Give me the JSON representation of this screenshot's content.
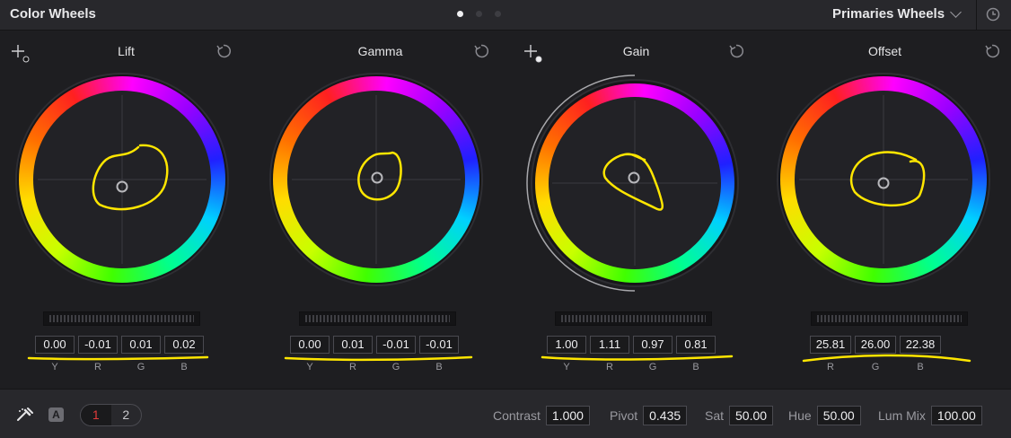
{
  "header": {
    "title": "Color Wheels",
    "mode_label": "Primaries Wheels",
    "page_dots": 3,
    "active_dot": 0
  },
  "wheels": [
    {
      "id": "lift",
      "title": "Lift",
      "values": [
        "0.00",
        "-0.01",
        "0.01",
        "0.02"
      ],
      "labels": [
        "Y",
        "R",
        "G",
        "B"
      ],
      "has_picker": true
    },
    {
      "id": "gamma",
      "title": "Gamma",
      "values": [
        "0.00",
        "0.01",
        "-0.01",
        "-0.01"
      ],
      "labels": [
        "Y",
        "R",
        "G",
        "B"
      ],
      "has_picker": false
    },
    {
      "id": "gain",
      "title": "Gain",
      "values": [
        "1.00",
        "1.11",
        "0.97",
        "0.81"
      ],
      "labels": [
        "Y",
        "R",
        "G",
        "B"
      ],
      "has_picker": true
    },
    {
      "id": "offset",
      "title": "Offset",
      "values": [
        "25.81",
        "26.00",
        "22.38"
      ],
      "labels": [
        "R",
        "G",
        "B"
      ],
      "has_picker": false
    }
  ],
  "footer": {
    "auto_label": "A",
    "pages": [
      "1",
      "2"
    ],
    "active_page": "1",
    "contrast": {
      "label": "Contrast",
      "value": "1.000"
    },
    "pivot": {
      "label": "Pivot",
      "value": "0.435"
    },
    "sat": {
      "label": "Sat",
      "value": "50.00"
    },
    "hue": {
      "label": "Hue",
      "value": "50.00"
    },
    "lum_mix": {
      "label": "Lum Mix",
      "value": "100.00"
    }
  },
  "icons": {
    "picker": "crosshair-picker-icon",
    "reset": "reset-icon",
    "eyedropper": "eyedropper-icon"
  },
  "colors": {
    "annotation": "#ffe600",
    "active_page": "#e33b3b",
    "background": "#1e1e21"
  }
}
